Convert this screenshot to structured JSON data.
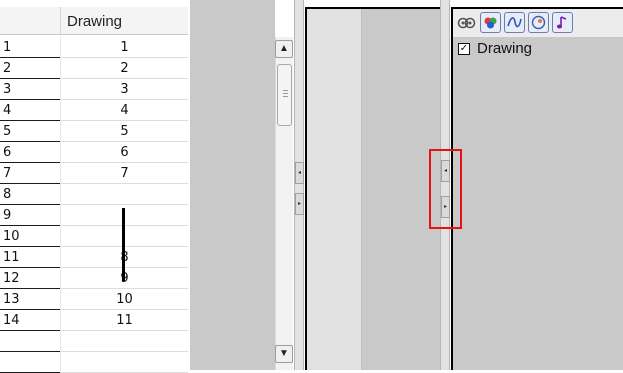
{
  "xsheet": {
    "column_header": "Drawing",
    "rows": [
      {
        "frame": "1",
        "drawing": "1"
      },
      {
        "frame": "2",
        "drawing": "2"
      },
      {
        "frame": "3",
        "drawing": "3"
      },
      {
        "frame": "4",
        "drawing": "4"
      },
      {
        "frame": "5",
        "drawing": "5"
      },
      {
        "frame": "6",
        "drawing": "6"
      },
      {
        "frame": "7",
        "drawing": "7"
      },
      {
        "frame": "8",
        "drawing": ""
      },
      {
        "frame": "9",
        "drawing": ""
      },
      {
        "frame": "10",
        "drawing": ""
      },
      {
        "frame": "11",
        "drawing": "8"
      },
      {
        "frame": "12",
        "drawing": "9"
      },
      {
        "frame": "13",
        "drawing": "10"
      },
      {
        "frame": "14",
        "drawing": "11"
      }
    ]
  },
  "scrollbar": {
    "up_glyph": "▲",
    "down_glyph": "▼"
  },
  "splitters": {
    "collapse_left_glyph": "◂",
    "expand_right_glyph": "▸"
  },
  "layer_panel": {
    "toolbar_icons": [
      "onion-skin-icon",
      "color-palette-icon",
      "curve-icon",
      "paint-icon",
      "sound-note-icon"
    ],
    "layer": {
      "name": "Drawing",
      "checked": true,
      "check_glyph": "✓"
    }
  },
  "colors": {
    "highlight": "#e81010",
    "panel_grey": "#c9c9c9",
    "button_border": "#6a7fb0"
  }
}
